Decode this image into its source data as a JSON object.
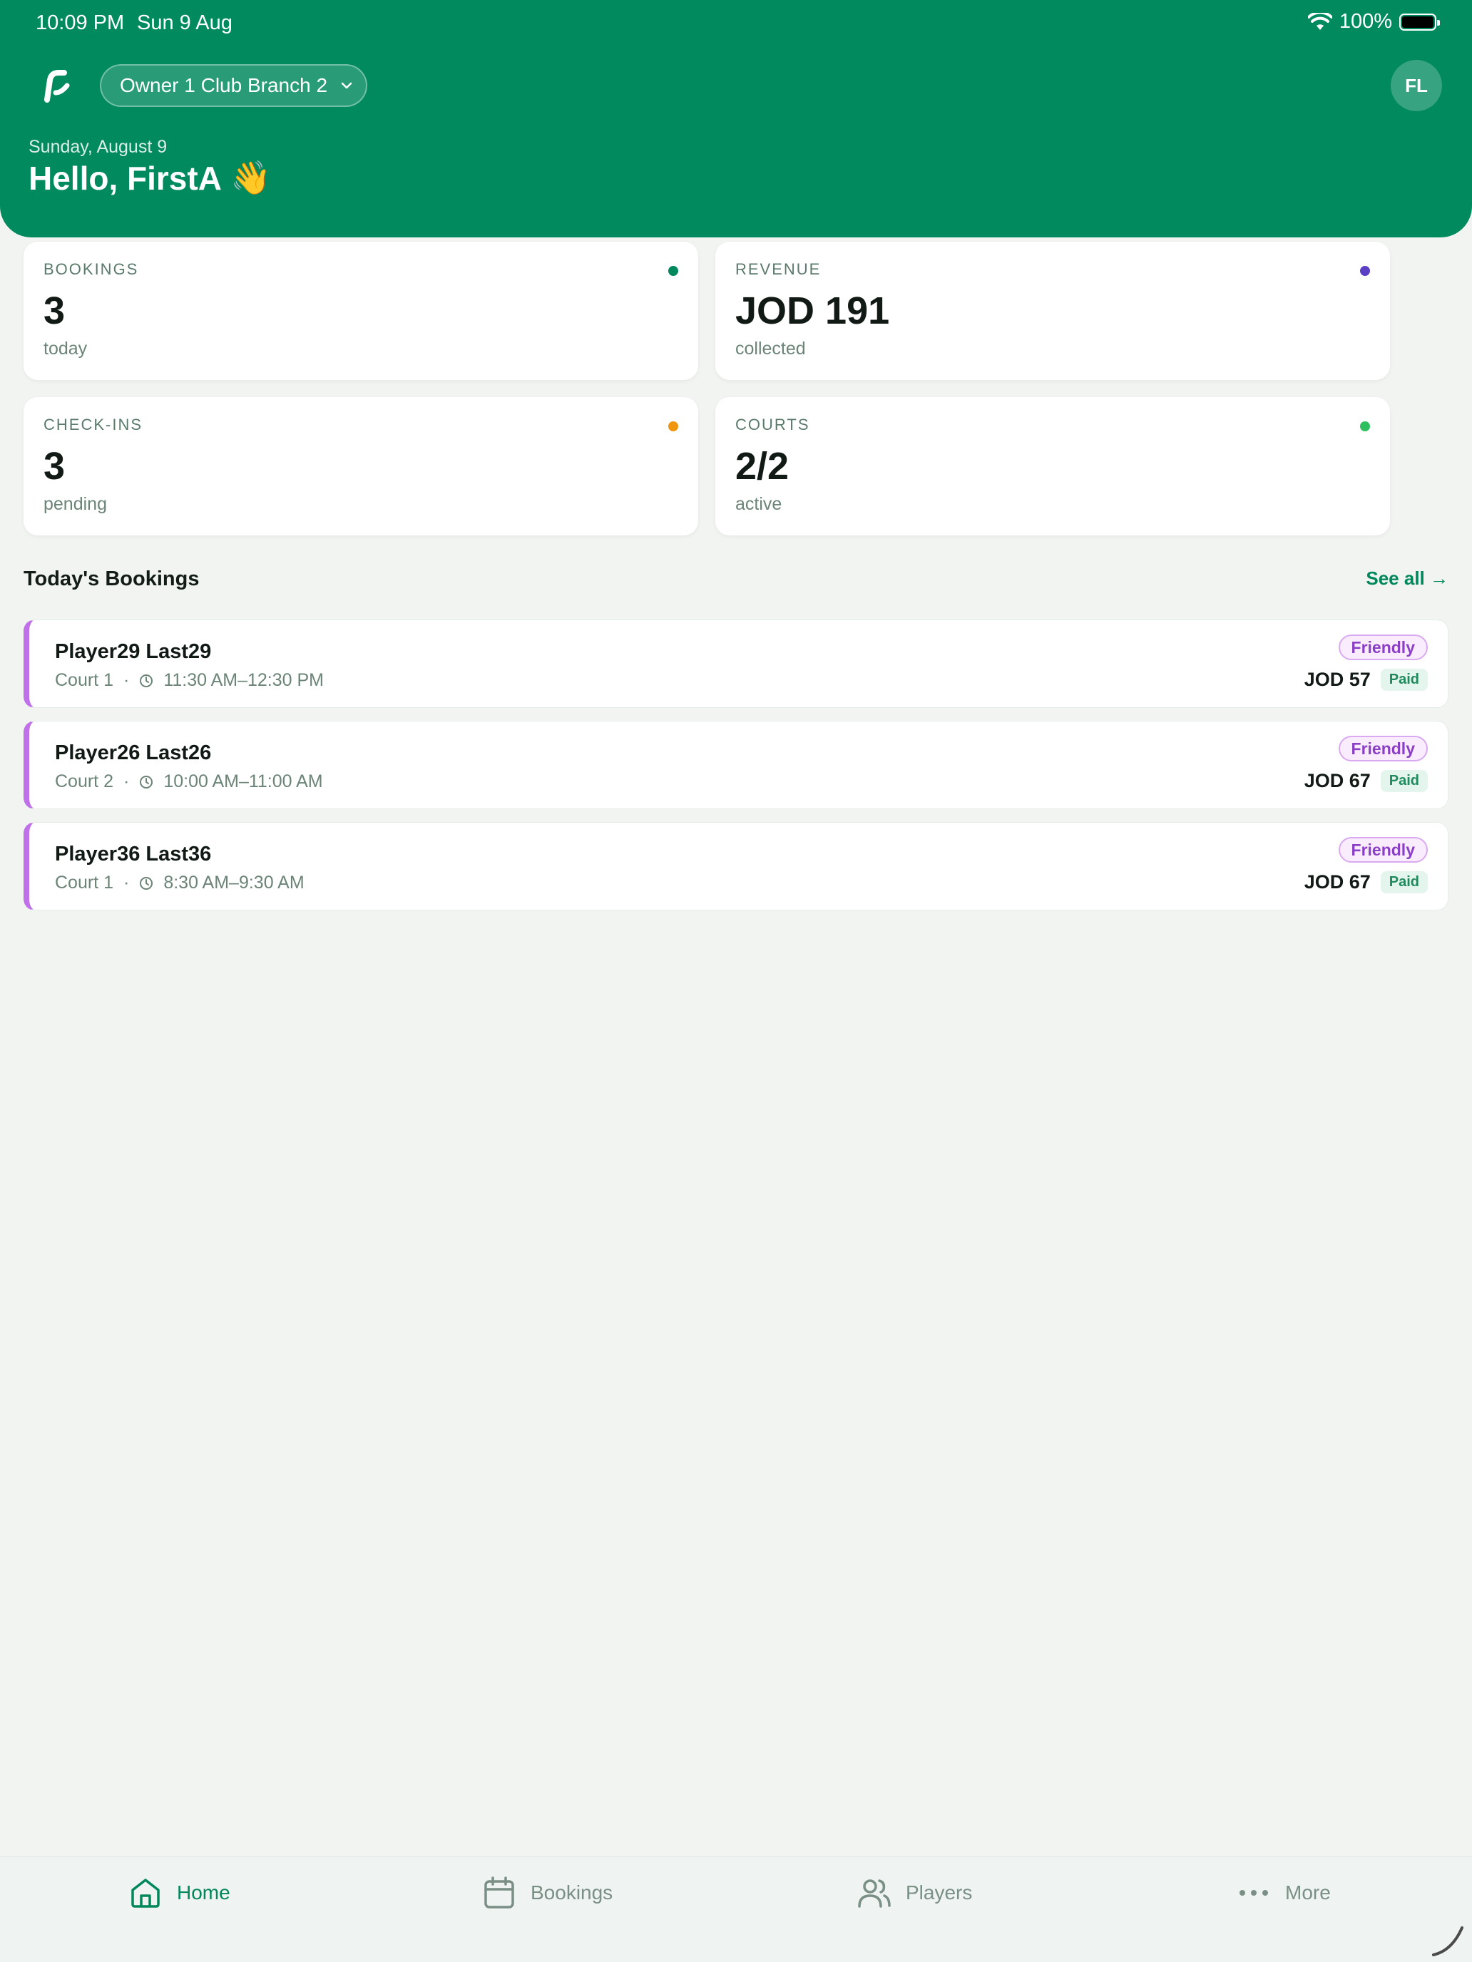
{
  "status_bar": {
    "time": "10:09 PM",
    "date": "Sun 9 Aug",
    "battery": "100%"
  },
  "header": {
    "club_name": "Owner 1 Club Branch 2",
    "avatar_initials": "FL",
    "date": "Sunday, August 9",
    "greeting": "Hello, FirstA",
    "greeting_emoji": "👋"
  },
  "stats": [
    {
      "label": "BOOKINGS",
      "value": "3",
      "sub": "today",
      "color": "#00875b"
    },
    {
      "label": "REVENUE",
      "value": "JOD 191",
      "sub": "collected",
      "color": "#5b3fc4"
    },
    {
      "label": "CHECK-INS",
      "value": "3",
      "sub": "pending",
      "color": "#f0960e"
    },
    {
      "label": "COURTS",
      "value": "2/2",
      "sub": "active",
      "color": "#2fbf5e"
    }
  ],
  "bookings_section": {
    "title": "Today's Bookings",
    "see_all": "See all →"
  },
  "bookings": [
    {
      "name": "Player29 Last29",
      "court": "Court 1",
      "time": "11:30 AM–12:30 PM",
      "type": "Friendly",
      "price": "JOD 57",
      "status": "Paid"
    },
    {
      "name": "Player26 Last26",
      "court": "Court 2",
      "time": "10:00 AM–11:00 AM",
      "type": "Friendly",
      "price": "JOD 67",
      "status": "Paid"
    },
    {
      "name": "Player36 Last36",
      "court": "Court 1",
      "time": "8:30 AM–9:30 AM",
      "type": "Friendly",
      "price": "JOD 67",
      "status": "Paid"
    }
  ],
  "tabs": [
    {
      "label": "Home",
      "icon": "home-icon",
      "active": true
    },
    {
      "label": "Bookings",
      "icon": "calendar-icon",
      "active": false
    },
    {
      "label": "Players",
      "icon": "users-icon",
      "active": false
    },
    {
      "label": "More",
      "icon": "more-icon",
      "active": false
    }
  ],
  "colors": {
    "brand": "#008a5e",
    "accent_text": "#00875b",
    "booking_stripe": "#c070e8"
  }
}
